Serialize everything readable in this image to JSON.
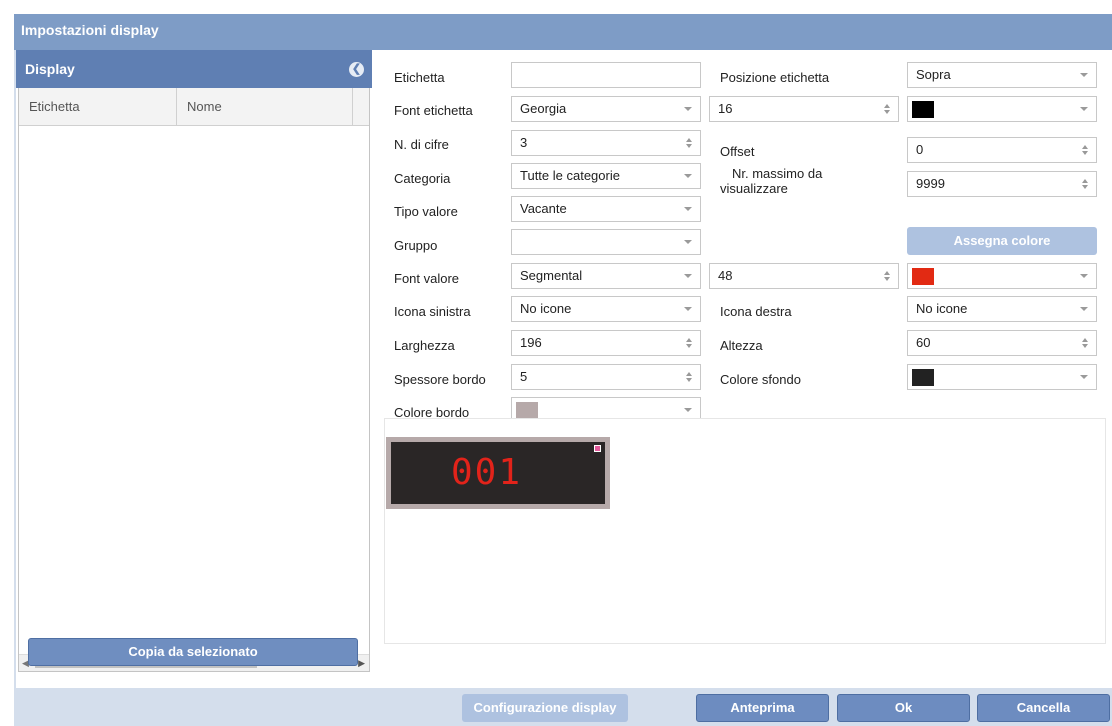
{
  "window": {
    "title": "Impostazioni display"
  },
  "left_panel": {
    "title": "Display",
    "columns": [
      "Etichetta",
      "Nome"
    ],
    "copy_button": "Copia da selezionato"
  },
  "form": {
    "etichetta": {
      "label": "Etichetta",
      "value": ""
    },
    "posizione_etichetta": {
      "label": "Posizione etichetta",
      "value": "Sopra"
    },
    "font_etichetta": {
      "label": "Font etichetta",
      "value": "Georgia",
      "size": "16",
      "color": "#000000"
    },
    "n_cifre": {
      "label": "N. di cifre",
      "value": "3"
    },
    "offset": {
      "label": "Offset",
      "value": "0"
    },
    "categoria": {
      "label": "Categoria",
      "value": "Tutte le categorie"
    },
    "nr_massimo": {
      "label_line1": "Nr. massimo da",
      "label_line2": "visualizzare",
      "value": "9999"
    },
    "tipo_valore": {
      "label": "Tipo valore",
      "value": "Vacante"
    },
    "gruppo": {
      "label": "Gruppo",
      "value": ""
    },
    "assegna_colore": "Assegna colore",
    "font_valore": {
      "label": "Font valore",
      "value": "Segmental",
      "size": "48",
      "color": "#e22a13"
    },
    "icona_sinistra": {
      "label": "Icona sinistra",
      "value": "No icone"
    },
    "icona_destra": {
      "label": "Icona destra",
      "value": "No icone"
    },
    "larghezza": {
      "label": "Larghezza",
      "value": "196"
    },
    "altezza": {
      "label": "Altezza",
      "value": "60"
    },
    "spessore_bordo": {
      "label": "Spessore bordo",
      "value": "5"
    },
    "colore_sfondo": {
      "label": "Colore sfondo",
      "color": "#222222"
    },
    "colore_bordo": {
      "label": "Colore bordo",
      "color": "#b6a9a9"
    }
  },
  "preview": {
    "digits": "001"
  },
  "footer": {
    "config": "Configurazione display",
    "anteprima": "Anteprima",
    "ok": "Ok",
    "cancella": "Cancella"
  }
}
